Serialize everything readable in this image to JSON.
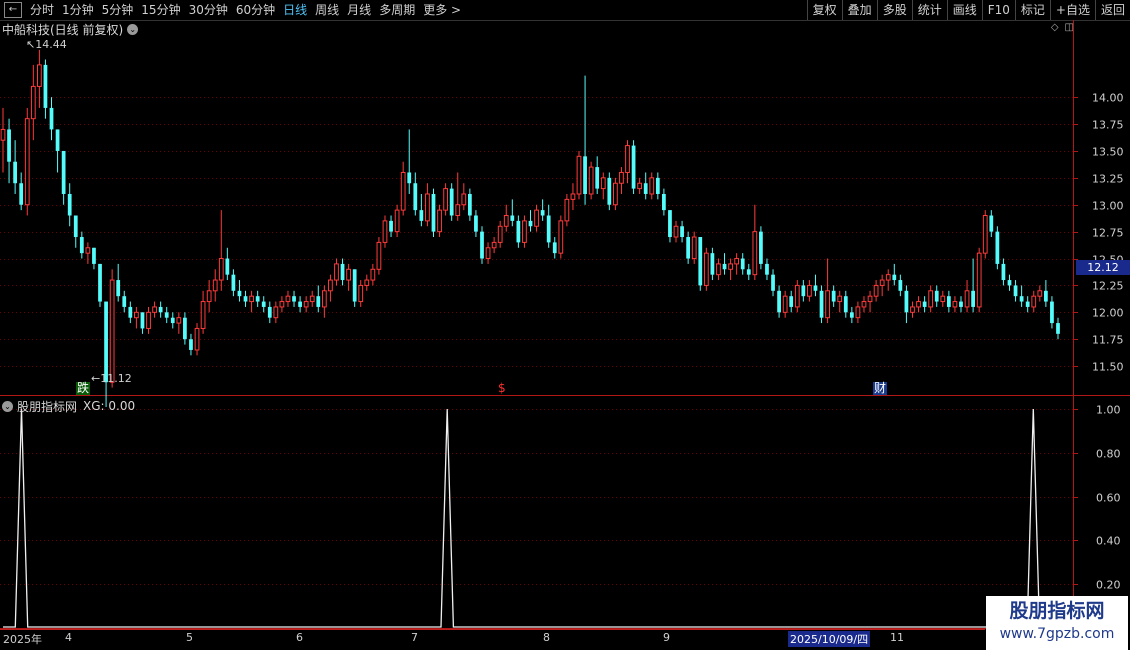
{
  "toolbar": {
    "back_icon": "back-arrow-icon",
    "periods": [
      "分时",
      "1分钟",
      "5分钟",
      "15分钟",
      "30分钟",
      "60分钟",
      "日线",
      "周线",
      "月线",
      "多周期",
      "更多 >"
    ],
    "active_period": "日线",
    "right_buttons": [
      "复权",
      "叠加",
      "多股",
      "统计",
      "画线",
      "F10",
      "标记",
      "+自选",
      "返回"
    ]
  },
  "main_chart": {
    "title": "中船科技(日线 前复权)",
    "high_label": "14.44",
    "low_label": "11.12",
    "current_price": "12.12",
    "markers": {
      "die": "跌",
      "dollar": "$",
      "cai": "财"
    },
    "colors": {
      "up": "#ff3b3b",
      "down": "#54fcfc",
      "grid": "#6a0000"
    }
  },
  "indicator": {
    "title": "股朋指标网",
    "value_text": "XG: 0.00"
  },
  "date_axis": {
    "labels": [
      "2025年",
      "4",
      "5",
      "6",
      "7",
      "8",
      "9",
      "2025/10/09/四",
      "11"
    ]
  },
  "watermark": {
    "title": "股朋指标网",
    "url": "www.7gpzb.com"
  },
  "chart_data": [
    {
      "type": "candlestick",
      "title": "中船科技(日线 前复权)",
      "ylim": [
        11.25,
        14.55
      ],
      "yticks": [
        "14.00",
        "13.75",
        "13.50",
        "13.25",
        "13.00",
        "12.75",
        "12.50",
        "12.25",
        "12.00",
        "11.75",
        "11.50"
      ],
      "ytick_values": [
        14.0,
        13.75,
        13.5,
        13.25,
        13.0,
        12.75,
        12.5,
        12.25,
        12.0,
        11.75,
        11.5
      ],
      "candles": [
        [
          13.6,
          13.9,
          13.3,
          13.7
        ],
        [
          13.7,
          13.8,
          13.2,
          13.4
        ],
        [
          13.4,
          13.6,
          13.1,
          13.2
        ],
        [
          13.2,
          13.3,
          12.95,
          13.0
        ],
        [
          13.0,
          13.9,
          12.9,
          13.8
        ],
        [
          13.8,
          14.3,
          13.6,
          14.1
        ],
        [
          14.1,
          14.44,
          13.9,
          14.3
        ],
        [
          14.3,
          14.35,
          13.8,
          13.9
        ],
        [
          13.9,
          14.0,
          13.6,
          13.7
        ],
        [
          13.7,
          13.7,
          13.3,
          13.5
        ],
        [
          13.5,
          13.5,
          13.0,
          13.1
        ],
        [
          13.1,
          13.2,
          12.8,
          12.9
        ],
        [
          12.9,
          12.9,
          12.6,
          12.7
        ],
        [
          12.7,
          12.75,
          12.5,
          12.55
        ],
        [
          12.55,
          12.65,
          12.45,
          12.6
        ],
        [
          12.6,
          12.6,
          12.4,
          12.45
        ],
        [
          12.45,
          12.45,
          12.05,
          12.1
        ],
        [
          12.1,
          12.1,
          11.12,
          11.35
        ],
        [
          11.35,
          12.4,
          11.3,
          12.3
        ],
        [
          12.3,
          12.45,
          12.1,
          12.15
        ],
        [
          12.15,
          12.2,
          12.0,
          12.05
        ],
        [
          12.05,
          12.1,
          11.9,
          11.95
        ],
        [
          11.95,
          12.05,
          11.85,
          12.0
        ],
        [
          12.0,
          12.0,
          11.8,
          11.85
        ],
        [
          11.85,
          12.05,
          11.8,
          12.0
        ],
        [
          12.0,
          12.1,
          11.95,
          12.05
        ],
        [
          12.05,
          12.1,
          11.95,
          12.0
        ],
        [
          12.0,
          12.05,
          11.9,
          11.95
        ],
        [
          11.95,
          12.0,
          11.85,
          11.9
        ],
        [
          11.9,
          12.0,
          11.8,
          11.95
        ],
        [
          11.95,
          12.0,
          11.7,
          11.75
        ],
        [
          11.75,
          11.8,
          11.6,
          11.65
        ],
        [
          11.65,
          11.9,
          11.6,
          11.85
        ],
        [
          11.85,
          12.2,
          11.8,
          12.1
        ],
        [
          12.1,
          12.3,
          12.0,
          12.2
        ],
        [
          12.2,
          12.4,
          12.1,
          12.3
        ],
        [
          12.3,
          12.95,
          12.2,
          12.5
        ],
        [
          12.5,
          12.6,
          12.3,
          12.35
        ],
        [
          12.35,
          12.4,
          12.15,
          12.2
        ],
        [
          12.2,
          12.3,
          12.1,
          12.15
        ],
        [
          12.15,
          12.2,
          12.05,
          12.1
        ],
        [
          12.1,
          12.2,
          12.0,
          12.15
        ],
        [
          12.15,
          12.2,
          12.05,
          12.1
        ],
        [
          12.1,
          12.15,
          12.0,
          12.05
        ],
        [
          12.05,
          12.1,
          11.9,
          11.95
        ],
        [
          11.95,
          12.1,
          11.9,
          12.05
        ],
        [
          12.05,
          12.15,
          12.0,
          12.1
        ],
        [
          12.1,
          12.2,
          12.05,
          12.15
        ],
        [
          12.15,
          12.2,
          12.05,
          12.1
        ],
        [
          12.1,
          12.15,
          12.0,
          12.05
        ],
        [
          12.05,
          12.15,
          12.0,
          12.1
        ],
        [
          12.1,
          12.2,
          12.05,
          12.15
        ],
        [
          12.15,
          12.25,
          12.0,
          12.05
        ],
        [
          12.05,
          12.25,
          11.95,
          12.2
        ],
        [
          12.2,
          12.35,
          12.1,
          12.3
        ],
        [
          12.3,
          12.5,
          12.25,
          12.45
        ],
        [
          12.45,
          12.5,
          12.25,
          12.3
        ],
        [
          12.3,
          12.45,
          12.2,
          12.4
        ],
        [
          12.4,
          12.4,
          12.05,
          12.1
        ],
        [
          12.1,
          12.3,
          12.05,
          12.25
        ],
        [
          12.25,
          12.35,
          12.2,
          12.3
        ],
        [
          12.3,
          12.45,
          12.25,
          12.4
        ],
        [
          12.4,
          12.7,
          12.35,
          12.65
        ],
        [
          12.65,
          12.9,
          12.6,
          12.85
        ],
        [
          12.85,
          12.9,
          12.7,
          12.75
        ],
        [
          12.75,
          13.0,
          12.7,
          12.95
        ],
        [
          12.95,
          13.4,
          12.9,
          13.3
        ],
        [
          13.3,
          13.7,
          13.1,
          13.2
        ],
        [
          13.2,
          13.3,
          12.9,
          12.95
        ],
        [
          12.95,
          13.1,
          12.8,
          12.85
        ],
        [
          12.85,
          13.2,
          12.8,
          13.1
        ],
        [
          13.1,
          13.15,
          12.7,
          12.75
        ],
        [
          12.75,
          13.0,
          12.7,
          12.95
        ],
        [
          12.95,
          13.2,
          12.9,
          13.15
        ],
        [
          13.15,
          13.2,
          12.85,
          12.9
        ],
        [
          12.9,
          13.3,
          12.85,
          13.0
        ],
        [
          13.0,
          13.2,
          12.95,
          13.1
        ],
        [
          13.1,
          13.15,
          12.85,
          12.9
        ],
        [
          12.9,
          12.95,
          12.7,
          12.75
        ],
        [
          12.75,
          12.8,
          12.45,
          12.5
        ],
        [
          12.5,
          12.65,
          12.45,
          12.6
        ],
        [
          12.6,
          12.7,
          12.55,
          12.65
        ],
        [
          12.65,
          12.85,
          12.6,
          12.8
        ],
        [
          12.8,
          13.0,
          12.75,
          12.9
        ],
        [
          12.9,
          13.05,
          12.8,
          12.85
        ],
        [
          12.85,
          12.9,
          12.6,
          12.65
        ],
        [
          12.65,
          12.9,
          12.6,
          12.85
        ],
        [
          12.85,
          12.95,
          12.75,
          12.8
        ],
        [
          12.8,
          13.0,
          12.75,
          12.95
        ],
        [
          12.95,
          13.05,
          12.85,
          12.9
        ],
        [
          12.9,
          13.0,
          12.6,
          12.65
        ],
        [
          12.65,
          12.7,
          12.5,
          12.55
        ],
        [
          12.55,
          12.9,
          12.5,
          12.85
        ],
        [
          12.85,
          13.1,
          12.8,
          13.05
        ],
        [
          13.05,
          13.2,
          12.95,
          13.1
        ],
        [
          13.1,
          13.5,
          13.05,
          13.45
        ],
        [
          13.45,
          14.2,
          13.0,
          13.1
        ],
        [
          13.1,
          13.4,
          13.05,
          13.35
        ],
        [
          13.35,
          13.45,
          13.1,
          13.15
        ],
        [
          13.15,
          13.3,
          13.05,
          13.25
        ],
        [
          13.25,
          13.3,
          12.95,
          13.0
        ],
        [
          13.0,
          13.25,
          12.95,
          13.2
        ],
        [
          13.2,
          13.35,
          13.1,
          13.3
        ],
        [
          13.3,
          13.6,
          13.2,
          13.55
        ],
        [
          13.55,
          13.6,
          13.1,
          13.15
        ],
        [
          13.15,
          13.25,
          13.1,
          13.2
        ],
        [
          13.2,
          13.3,
          13.05,
          13.1
        ],
        [
          13.1,
          13.3,
          13.05,
          13.25
        ],
        [
          13.25,
          13.3,
          13.05,
          13.1
        ],
        [
          13.1,
          13.15,
          12.9,
          12.95
        ],
        [
          12.95,
          12.95,
          12.65,
          12.7
        ],
        [
          12.7,
          12.85,
          12.65,
          12.8
        ],
        [
          12.8,
          12.85,
          12.65,
          12.7
        ],
        [
          12.7,
          12.75,
          12.45,
          12.5
        ],
        [
          12.5,
          12.75,
          12.45,
          12.7
        ],
        [
          12.7,
          12.7,
          12.2,
          12.25
        ],
        [
          12.25,
          12.6,
          12.2,
          12.55
        ],
        [
          12.55,
          12.6,
          12.3,
          12.35
        ],
        [
          12.35,
          12.5,
          12.3,
          12.45
        ],
        [
          12.45,
          12.55,
          12.35,
          12.4
        ],
        [
          12.4,
          12.5,
          12.3,
          12.45
        ],
        [
          12.45,
          12.55,
          12.35,
          12.5
        ],
        [
          12.5,
          12.55,
          12.35,
          12.4
        ],
        [
          12.4,
          12.45,
          12.3,
          12.35
        ],
        [
          12.35,
          13.0,
          12.3,
          12.75
        ],
        [
          12.75,
          12.8,
          12.4,
          12.45
        ],
        [
          12.45,
          12.5,
          12.3,
          12.35
        ],
        [
          12.35,
          12.4,
          12.15,
          12.2
        ],
        [
          12.2,
          12.25,
          11.95,
          12.0
        ],
        [
          12.0,
          12.2,
          11.95,
          12.15
        ],
        [
          12.15,
          12.2,
          12.0,
          12.05
        ],
        [
          12.05,
          12.3,
          12.0,
          12.25
        ],
        [
          12.25,
          12.3,
          12.1,
          12.15
        ],
        [
          12.15,
          12.3,
          12.1,
          12.25
        ],
        [
          12.25,
          12.35,
          12.15,
          12.2
        ],
        [
          12.2,
          12.25,
          11.9,
          11.95
        ],
        [
          11.95,
          12.5,
          11.9,
          12.2
        ],
        [
          12.2,
          12.25,
          12.05,
          12.1
        ],
        [
          12.1,
          12.2,
          12.0,
          12.15
        ],
        [
          12.15,
          12.2,
          11.95,
          12.0
        ],
        [
          12.0,
          12.05,
          11.9,
          11.95
        ],
        [
          11.95,
          12.1,
          11.9,
          12.05
        ],
        [
          12.05,
          12.15,
          12.0,
          12.1
        ],
        [
          12.1,
          12.2,
          12.0,
          12.15
        ],
        [
          12.15,
          12.3,
          12.1,
          12.25
        ],
        [
          12.25,
          12.35,
          12.15,
          12.3
        ],
        [
          12.3,
          12.4,
          12.2,
          12.35
        ],
        [
          12.35,
          12.45,
          12.25,
          12.3
        ],
        [
          12.3,
          12.35,
          12.15,
          12.2
        ],
        [
          12.2,
          12.25,
          11.9,
          12.0
        ],
        [
          12.0,
          12.1,
          11.95,
          12.05
        ],
        [
          12.05,
          12.15,
          12.0,
          12.1
        ],
        [
          12.1,
          12.15,
          12.0,
          12.05
        ],
        [
          12.05,
          12.25,
          12.0,
          12.2
        ],
        [
          12.2,
          12.25,
          12.05,
          12.1
        ],
        [
          12.1,
          12.2,
          12.05,
          12.15
        ],
        [
          12.15,
          12.2,
          12.0,
          12.05
        ],
        [
          12.05,
          12.15,
          12.0,
          12.1
        ],
        [
          12.1,
          12.15,
          12.0,
          12.05
        ],
        [
          12.05,
          12.3,
          12.0,
          12.2
        ],
        [
          12.2,
          12.5,
          12.0,
          12.05
        ],
        [
          12.05,
          12.6,
          12.0,
          12.55
        ],
        [
          12.55,
          12.95,
          12.5,
          12.9
        ],
        [
          12.9,
          12.95,
          12.7,
          12.75
        ],
        [
          12.75,
          12.8,
          12.4,
          12.45
        ],
        [
          12.45,
          12.5,
          12.25,
          12.3
        ],
        [
          12.3,
          12.35,
          12.2,
          12.25
        ],
        [
          12.25,
          12.3,
          12.1,
          12.15
        ],
        [
          12.15,
          12.25,
          12.05,
          12.1
        ],
        [
          12.1,
          12.15,
          12.0,
          12.05
        ],
        [
          12.05,
          12.2,
          12.0,
          12.15
        ],
        [
          12.15,
          12.25,
          12.1,
          12.2
        ],
        [
          12.2,
          12.3,
          12.05,
          12.1
        ],
        [
          12.1,
          12.15,
          11.85,
          11.9
        ],
        [
          11.9,
          11.95,
          11.75,
          11.8
        ]
      ]
    },
    {
      "type": "line",
      "title": "股朋指标网",
      "series": [
        {
          "name": "XG"
        }
      ],
      "yticks": [
        "1.00",
        "0.80",
        "0.60",
        "0.40",
        "0.20"
      ],
      "ytick_values": [
        1.0,
        0.8,
        0.6,
        0.4,
        0.2
      ],
      "ylim": [
        0,
        1.05
      ],
      "bars": 172,
      "signal_bars": [
        3,
        72,
        167
      ]
    }
  ]
}
